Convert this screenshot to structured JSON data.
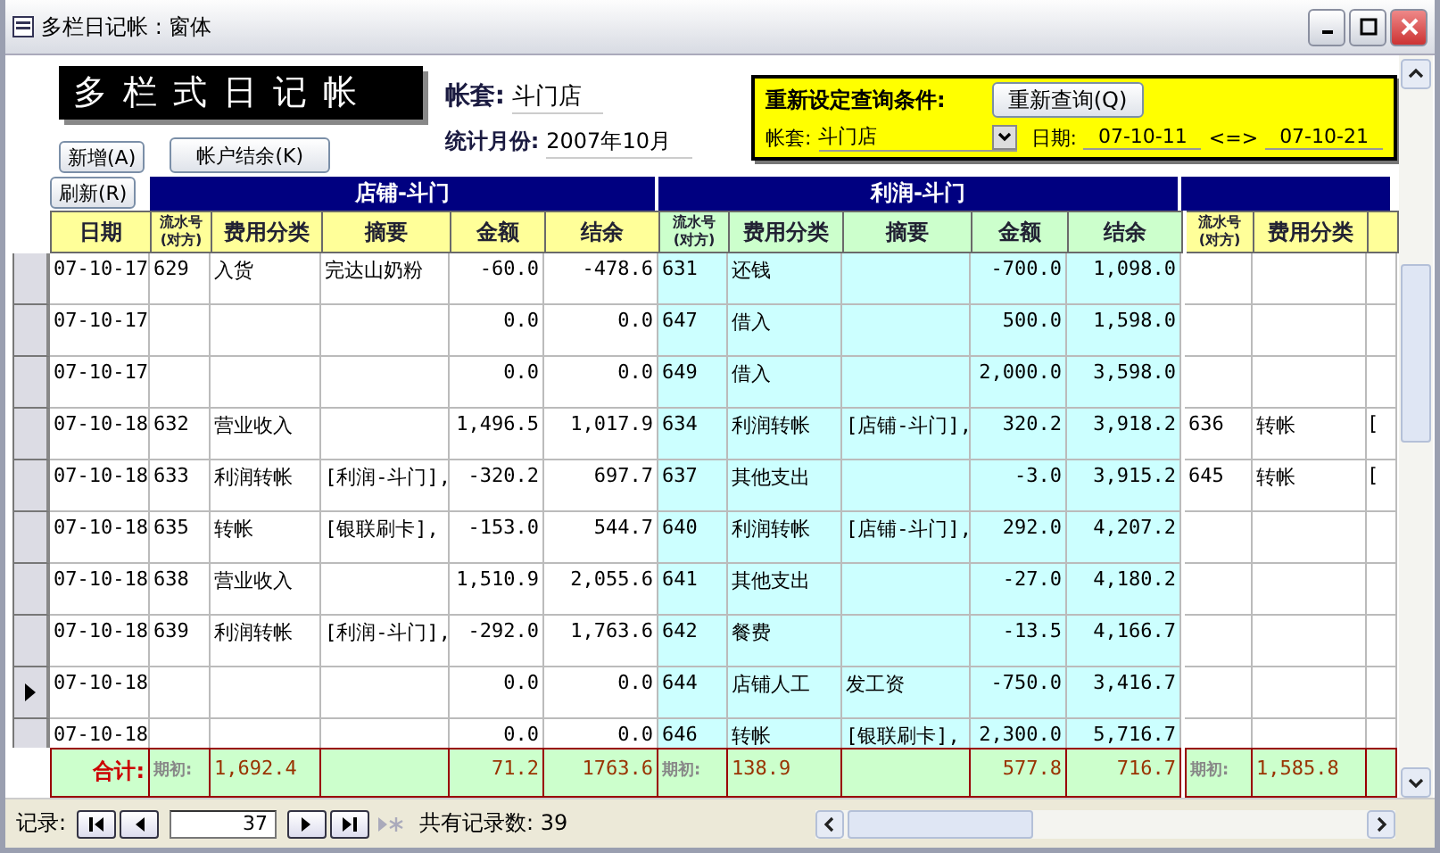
{
  "window": {
    "title": "多栏日记帐 : 窗体"
  },
  "banner": "多栏式日记帐",
  "account": {
    "label": "帐套:",
    "value": "斗门店"
  },
  "month": {
    "label": "统计月份:",
    "value": "2007年10月"
  },
  "buttons": [
    {
      "label": "新增(A)"
    },
    {
      "label": "刷新(R)"
    },
    {
      "label": "帐户结余(K)"
    }
  ],
  "query": {
    "title": "重新设定查询条件:",
    "button": "重新查询(Q)",
    "account_label": "帐套:",
    "account_value": "斗门店",
    "date_label": "日期:",
    "date_from": "07-10-11",
    "separator": "<=>",
    "date_to": "07-10-21"
  },
  "date_header": "日期",
  "groups": [
    {
      "title": "店铺-斗门",
      "columns": [
        "流水号\n(对方)",
        "费用分类",
        "摘要",
        "金额",
        "结余"
      ]
    },
    {
      "title": "利润-斗门",
      "columns": [
        "流水号\n(对方)",
        "费用分类",
        "摘要",
        "金额",
        "结余"
      ]
    },
    {
      "columns": [
        "流水号\n(对方)",
        "费用分类"
      ]
    }
  ],
  "rows": [
    {
      "date": "07-10-17",
      "current": false,
      "cells": [
        {
          "no": "629",
          "category": "入货",
          "memo": "完达山奶粉",
          "amount": "-60.0",
          "balance": "-478.6"
        },
        {
          "no": "631",
          "category": "还钱",
          "amount": "-700.0",
          "balance": "1,098.0"
        },
        {}
      ]
    },
    {
      "date": "07-10-17",
      "current": false,
      "cells": [
        {
          "amount": "0.0",
          "balance": "0.0"
        },
        {
          "no": "647",
          "category": "借入",
          "amount": "500.0",
          "balance": "1,598.0"
        },
        {}
      ]
    },
    {
      "date": "07-10-17",
      "current": false,
      "cells": [
        {
          "amount": "0.0",
          "balance": "0.0"
        },
        {
          "no": "649",
          "category": "借入",
          "amount": "2,000.0",
          "balance": "3,598.0"
        },
        {}
      ]
    },
    {
      "date": "07-10-18",
      "current": false,
      "cells": [
        {
          "no": "632",
          "category": "营业收入",
          "amount": "1,496.5",
          "balance": "1,017.9"
        },
        {
          "no": "634",
          "category": "利润转帐",
          "memo": "[店铺-斗门],",
          "amount": "320.2",
          "balance": "3,918.2"
        },
        {
          "no": "636",
          "category": "转帐",
          "memo": "["
        }
      ]
    },
    {
      "date": "07-10-18",
      "current": false,
      "cells": [
        {
          "no": "633",
          "category": "利润转帐",
          "memo": "[利润-斗门],",
          "amount": "-320.2",
          "balance": "697.7"
        },
        {
          "no": "637",
          "category": "其他支出",
          "amount": "-3.0",
          "balance": "3,915.2"
        },
        {
          "no": "645",
          "category": "转帐",
          "memo": "["
        }
      ]
    },
    {
      "date": "07-10-18",
      "current": false,
      "cells": [
        {
          "no": "635",
          "category": "转帐",
          "memo": "[银联刷卡],",
          "amount": "-153.0",
          "balance": "544.7"
        },
        {
          "no": "640",
          "category": "利润转帐",
          "memo": "[店铺-斗门],",
          "amount": "292.0",
          "balance": "4,207.2"
        },
        {}
      ]
    },
    {
      "date": "07-10-18",
      "current": false,
      "cells": [
        {
          "no": "638",
          "category": "营业收入",
          "amount": "1,510.9",
          "balance": "2,055.6"
        },
        {
          "no": "641",
          "category": "其他支出",
          "amount": "-27.0",
          "balance": "4,180.2"
        },
        {}
      ]
    },
    {
      "date": "07-10-18",
      "current": false,
      "cells": [
        {
          "no": "639",
          "category": "利润转帐",
          "memo": "[利润-斗门],",
          "amount": "-292.0",
          "balance": "1,763.6"
        },
        {
          "no": "642",
          "category": "餐费",
          "amount": "-13.5",
          "balance": "4,166.7"
        },
        {}
      ]
    },
    {
      "date": "07-10-18",
      "current": true,
      "cells": [
        {
          "amount": "0.0",
          "balance": "0.0"
        },
        {
          "no": "644",
          "category": "店铺人工",
          "memo": "发工资",
          "amount": "-750.0",
          "balance": "3,416.7"
        },
        {}
      ]
    },
    {
      "date": "07-10-18",
      "current": false,
      "cells": [
        {
          "amount": "0.0",
          "balance": "0.0"
        },
        {
          "no": "646",
          "category": "转帐",
          "memo": "[银联刷卡],",
          "amount": "2,300.0",
          "balance": "5,716.7"
        },
        {}
      ]
    }
  ],
  "totals": {
    "label": "合计:",
    "cells": [
      {
        "no": "期初:",
        "category": "1,692.4",
        "amount": "71.2",
        "balance": "1763.6"
      },
      {
        "no": "期初:",
        "category": "138.9",
        "amount": "577.8",
        "balance": "716.7"
      },
      {
        "no": "期初:",
        "category": "1,585.8"
      }
    ]
  },
  "navigator": {
    "label": "记录:",
    "record": "37",
    "count": "共有记录数: 39"
  }
}
